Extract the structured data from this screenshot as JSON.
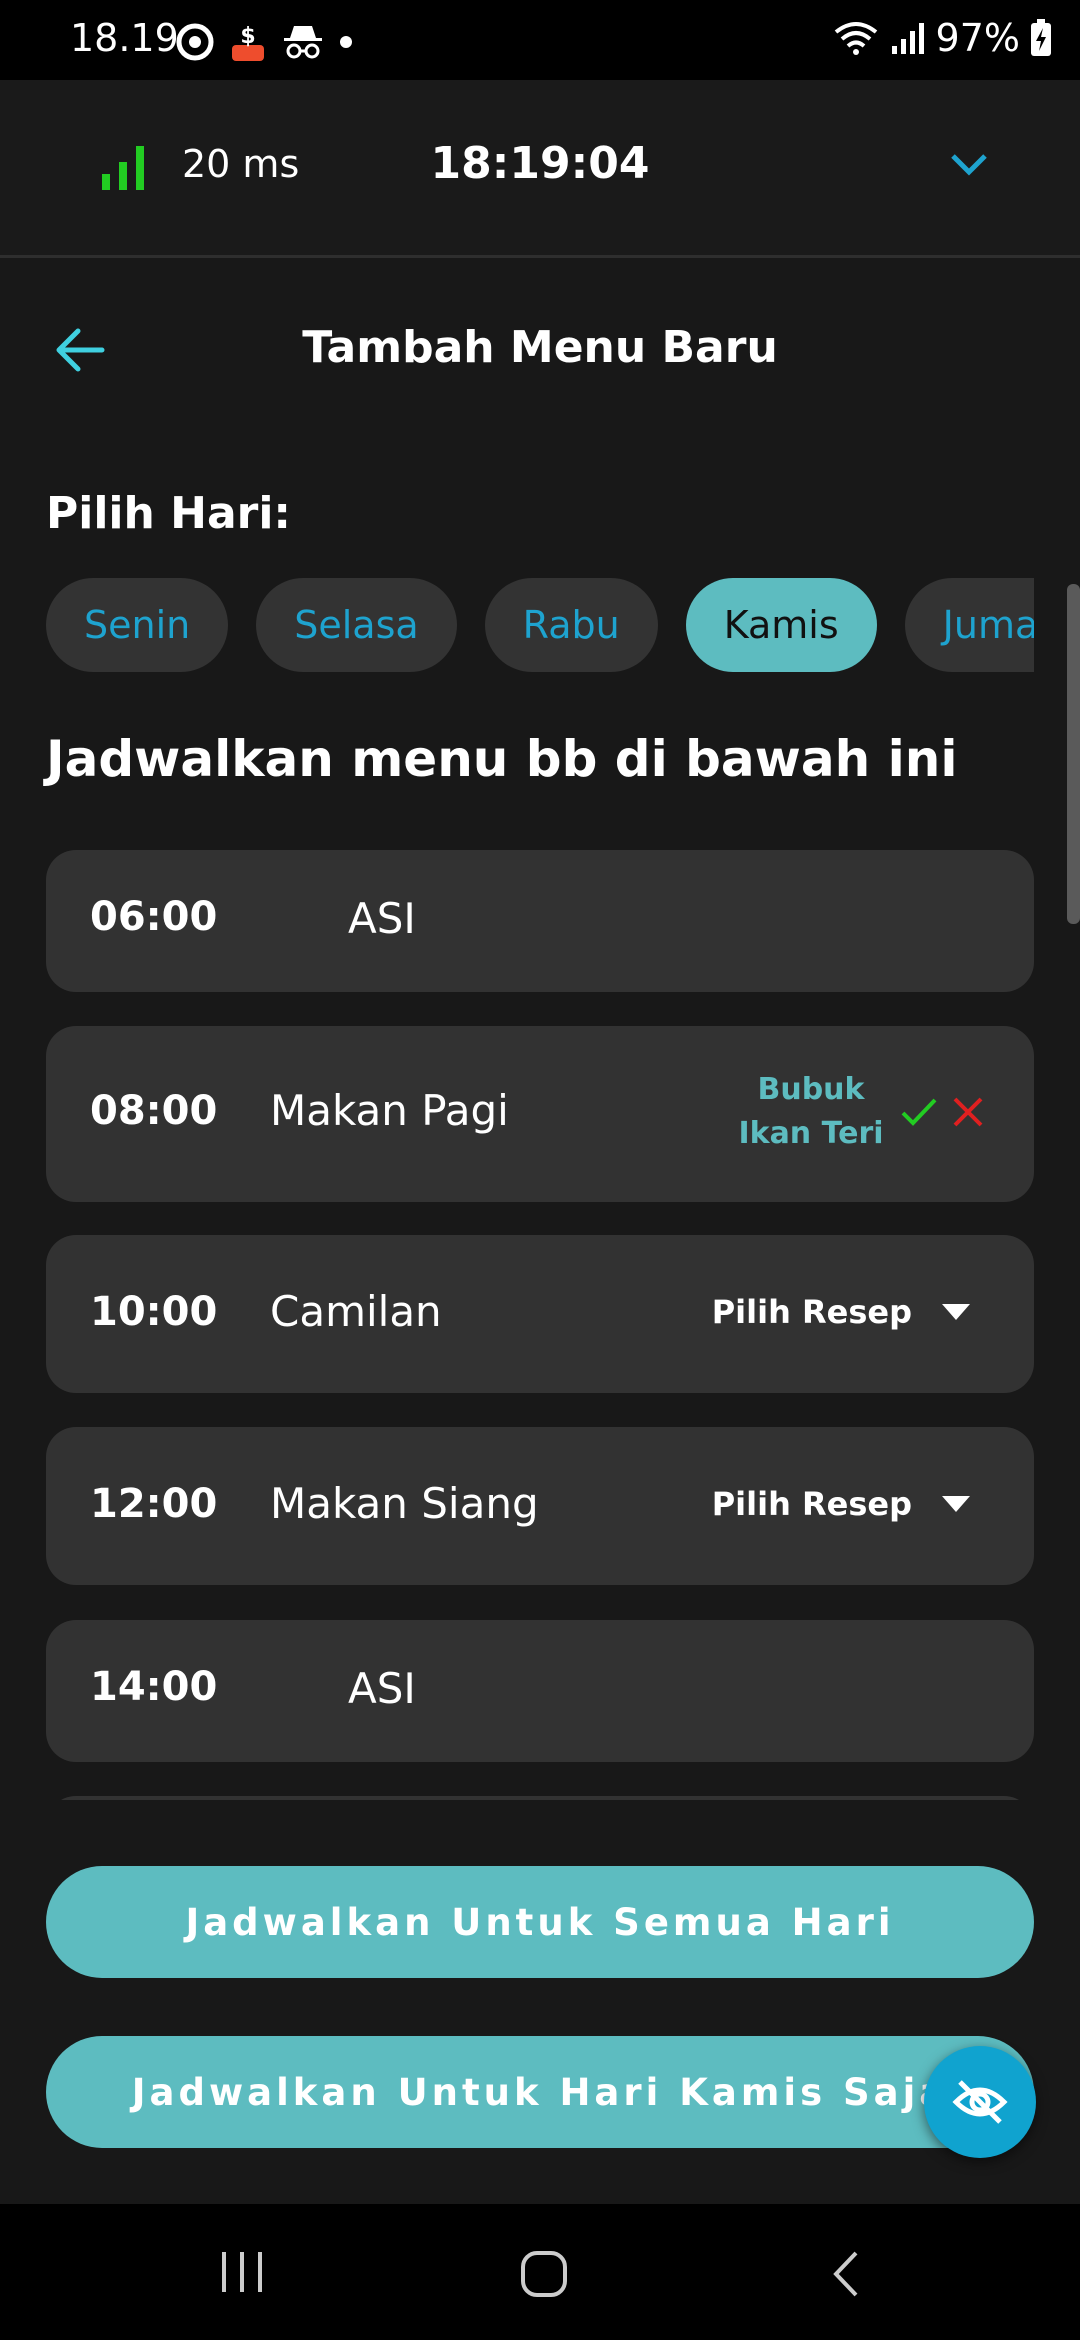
{
  "status_bar": {
    "time": "18.19",
    "battery": "97%",
    "left_icons": [
      "location-icon",
      "shopee-icon",
      "incognito-icon",
      "dot-icon"
    ],
    "right_icons": [
      "wifi-icon",
      "signal-icon",
      "battery-charging-icon"
    ]
  },
  "network_bar": {
    "ping": "20 ms",
    "clock": "18:19:04",
    "ping_color": "#22cc22",
    "chevron_color": "#1ea3cf"
  },
  "header": {
    "title": "Tambah Menu Baru",
    "back_icon": "arrow-left-icon"
  },
  "day_picker": {
    "label": "Pilih Hari:",
    "days": [
      {
        "name": "Senin",
        "selected": false
      },
      {
        "name": "Selasa",
        "selected": false
      },
      {
        "name": "Rabu",
        "selected": false
      },
      {
        "name": "Kamis",
        "selected": true
      },
      {
        "name": "Jumat",
        "selected": false
      }
    ]
  },
  "schedule": {
    "heading": "Jadwalkan menu bb di bawah ini",
    "slots": [
      {
        "time": "06:00",
        "label": "ASI"
      },
      {
        "time": "08:00",
        "label": "Makan Pagi",
        "recipe": "Bubuk Ikan Teri"
      },
      {
        "time": "10:00",
        "label": "Camilan",
        "picker": "Pilih Resep"
      },
      {
        "time": "12:00",
        "label": "Makan Siang",
        "picker": "Pilih Resep"
      },
      {
        "time": "14:00",
        "label": "ASI"
      }
    ]
  },
  "actions": {
    "all_days": "Jadwalkan Untuk Semua Hari",
    "this_day": "Jadwalkan Untuk Hari Kamis Saja",
    "fab_icon": "eye-off-icon"
  },
  "colors": {
    "accent": "#5dbcc0",
    "blue": "#1ea3cf",
    "card": "#323232",
    "background": "#181818",
    "confirm": "#22cc22",
    "cancel": "#e02020"
  }
}
